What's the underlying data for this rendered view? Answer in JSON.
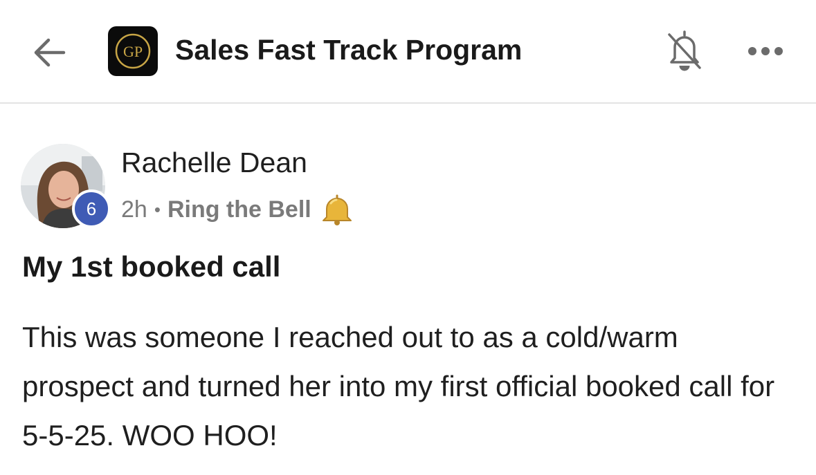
{
  "header": {
    "back_icon": "arrow-left-icon",
    "group_logo_text": "GP",
    "group_name": "Sales Fast Track Program",
    "notification_icon": "bell-off-icon",
    "more_icon": "more-horizontal-icon"
  },
  "post": {
    "author": {
      "name": "Rachelle Dean",
      "level": "6"
    },
    "time": "2h",
    "separator": "•",
    "category": "Ring the Bell",
    "category_icon": "bell-emoji-icon",
    "title": "My 1st booked call",
    "body": "This was someone I reached out to as a cold/warm prospect and turned her into my first official booked call for 5-5-25. WOO HOO!"
  },
  "colors": {
    "level_badge": "#3f5bb5",
    "logo_gold": "#c9a646",
    "meta_gray": "#7a7a7a",
    "bell_gold": "#e8b53a"
  }
}
